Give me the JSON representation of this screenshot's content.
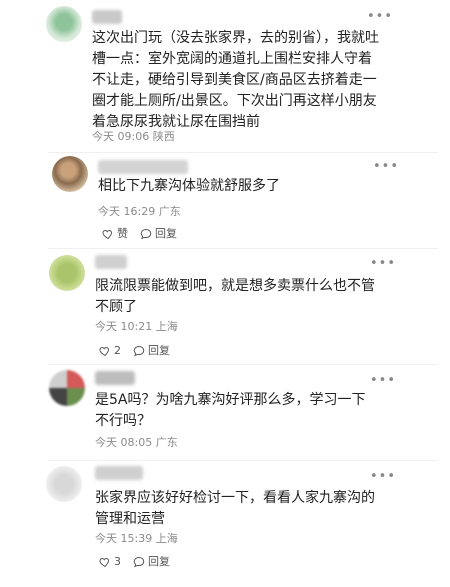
{
  "comments": [
    {
      "text": "这次出门玩（没去张家界，去的别省），我就吐槽一点：室外宽阔的通道扎上围栏安排人守着不让走，硬给引导到美食区/商品区去挤着走一圈才能上厕所/出景区。下次出门再这样小朋友着急尿尿我就让尿在围挡前",
      "time": "今天 09:06",
      "location": "陕西"
    },
    {
      "text": "相比下九寨沟体验就舒服多了",
      "time": "今天 16:29",
      "location": "广东",
      "like_label": "赞",
      "reply_label": "回复"
    },
    {
      "text": "限流限票能做到吧，就是想多卖票什么也不管不顾了",
      "time": "今天 10:21",
      "location": "上海",
      "like_count": "2",
      "reply_label": "回复"
    },
    {
      "text": "是5A吗？为啥九寨沟好评那么多，学习一下不行吗？",
      "time": "今天 08:05",
      "location": "广东"
    },
    {
      "text": "张家界应该好好检讨一下，看看人家九寨沟的管理和运营",
      "time": "今天 15:39",
      "location": "上海",
      "like_count": "3",
      "reply_label": "回复"
    }
  ],
  "more_icon": "more-dots-icon",
  "like_icon": "heart-icon",
  "reply_icon": "comment-bubble-icon"
}
